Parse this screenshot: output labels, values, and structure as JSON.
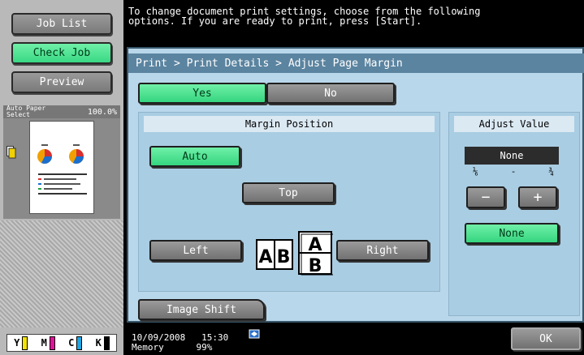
{
  "sidebar": {
    "job_list": "Job List",
    "check_job": "Check Job",
    "preview": "Preview",
    "paper_label": "Auto Paper\nSelect",
    "zoom": "100.0%",
    "toner": [
      "Y",
      "M",
      "C",
      "K"
    ],
    "toner_colors": [
      "#f2e300",
      "#e0129a",
      "#1fa6e0",
      "#000000"
    ]
  },
  "message": "To change document print settings, choose from the following\noptions. If you are ready to print, press [Start].",
  "breadcrumb": "Print > Print Details > Adjust Page Margin",
  "toggle": {
    "yes": "Yes",
    "no": "No"
  },
  "margin_position": {
    "title": "Margin Position",
    "auto": "Auto",
    "top": "Top",
    "left": "Left",
    "right": "Right"
  },
  "adjust_value": {
    "title": "Adjust Value",
    "value": "None",
    "range_min": "⅙",
    "range_sep": "-",
    "range_max": "¾",
    "minus": "−",
    "plus": "+",
    "none": "None"
  },
  "image_shift": "Image Shift",
  "status": {
    "date": "10/09/2008",
    "time": "15:30",
    "memory_label": "Memory",
    "memory_value": "99%"
  },
  "ok": "OK"
}
